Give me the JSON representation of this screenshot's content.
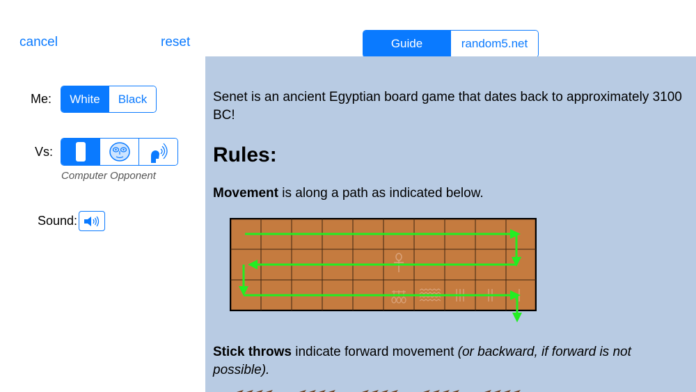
{
  "header": {
    "cancel_label": "cancel",
    "reset_label": "reset",
    "tabs": [
      {
        "label": "Guide",
        "active": true
      },
      {
        "label": "random5.net",
        "active": false
      }
    ]
  },
  "settings": {
    "me_label": "Me:",
    "me_options": [
      {
        "label": "White",
        "selected": true
      },
      {
        "label": "Black",
        "selected": false
      }
    ],
    "vs_label": "Vs:",
    "vs_options": [
      {
        "icon": "human-player-icon",
        "selected": true
      },
      {
        "icon": "computer-face-icon",
        "selected": false
      },
      {
        "icon": "remote-player-icon",
        "selected": false
      }
    ],
    "vs_caption": "Computer Opponent",
    "sound_label": "Sound:",
    "sound_icon": "speaker-icon"
  },
  "guide": {
    "intro": "Senet is an ancient Egyptian board game that dates back to approximately 3100 BC!",
    "rules_heading": "Rules:",
    "movement_bold": "Movement",
    "movement_text": " is along a path as indicated below.",
    "throws_bold": "Stick throws",
    "throws_text": " indicate forward movement ",
    "throws_italic": "(or backward, if forward is not possible).",
    "board": {
      "rows": 3,
      "cols": 10,
      "cell_color": "#c57b3f",
      "arrow_color": "#22ee22",
      "symbols": [
        "ankh",
        "three-ankhs",
        "water",
        "three-marks",
        "two-marks",
        "one-mark"
      ]
    }
  },
  "colors": {
    "accent": "#0a7aff",
    "guide_bg": "#b8cbe3"
  }
}
